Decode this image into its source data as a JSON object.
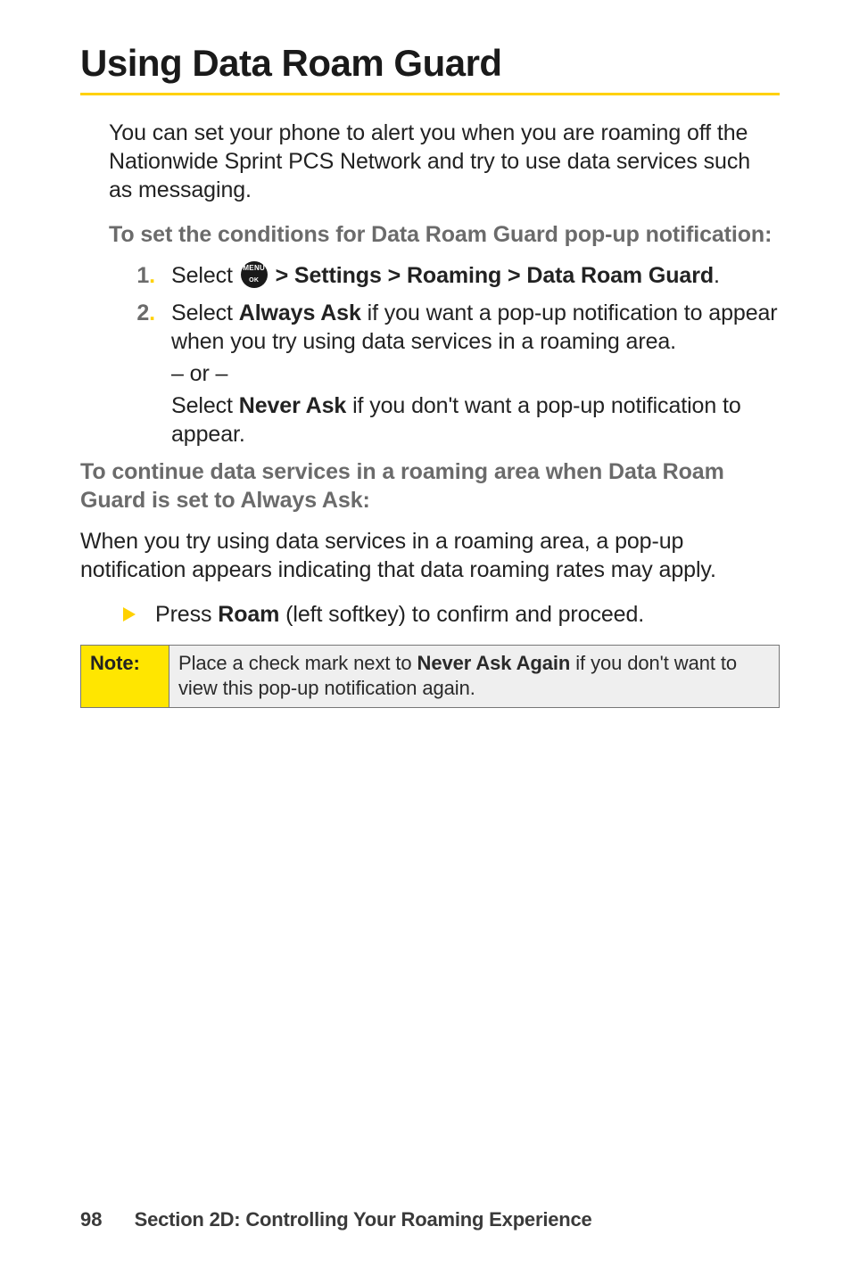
{
  "title": "Using Data Roam Guard",
  "intro": "You can set your phone to alert you when you are roaming off the Nationwide Sprint PCS Network and try to use data services such as messaging.",
  "subhead1": "To set the conditions for Data Roam Guard pop-up notification:",
  "step1": {
    "num": "1",
    "prefix": "Select ",
    "path": " > Settings > Roaming > Data Roam Guard",
    "suffix": "."
  },
  "step2": {
    "num": "2",
    "prefix": "Select ",
    "always_ask": "Always Ask",
    "always_rest": " if you want a pop-up notification to appear when you try using data services in a roaming area.",
    "or": "– or –",
    "never_prefix": "Select ",
    "never_ask": "Never Ask",
    "never_rest": " if you don't want a pop-up notification to appear."
  },
  "subhead2": "To continue data services in a roaming area when Data Roam Guard is set to Always Ask:",
  "para2": "When you try using data services in a roaming area, a pop-up notification appears indicating that data roaming rates may apply.",
  "press_line": {
    "prefix": "Press ",
    "roam": "Roam",
    "rest": " (left softkey) to confirm and proceed."
  },
  "note": {
    "label": "Note:",
    "prefix": "Place a check mark next to ",
    "bold": "Never Ask Again",
    "rest": " if you don't want to view this pop-up notification again."
  },
  "footer": {
    "page": "98",
    "section": "Section 2D: Controlling Your Roaming Experience"
  }
}
